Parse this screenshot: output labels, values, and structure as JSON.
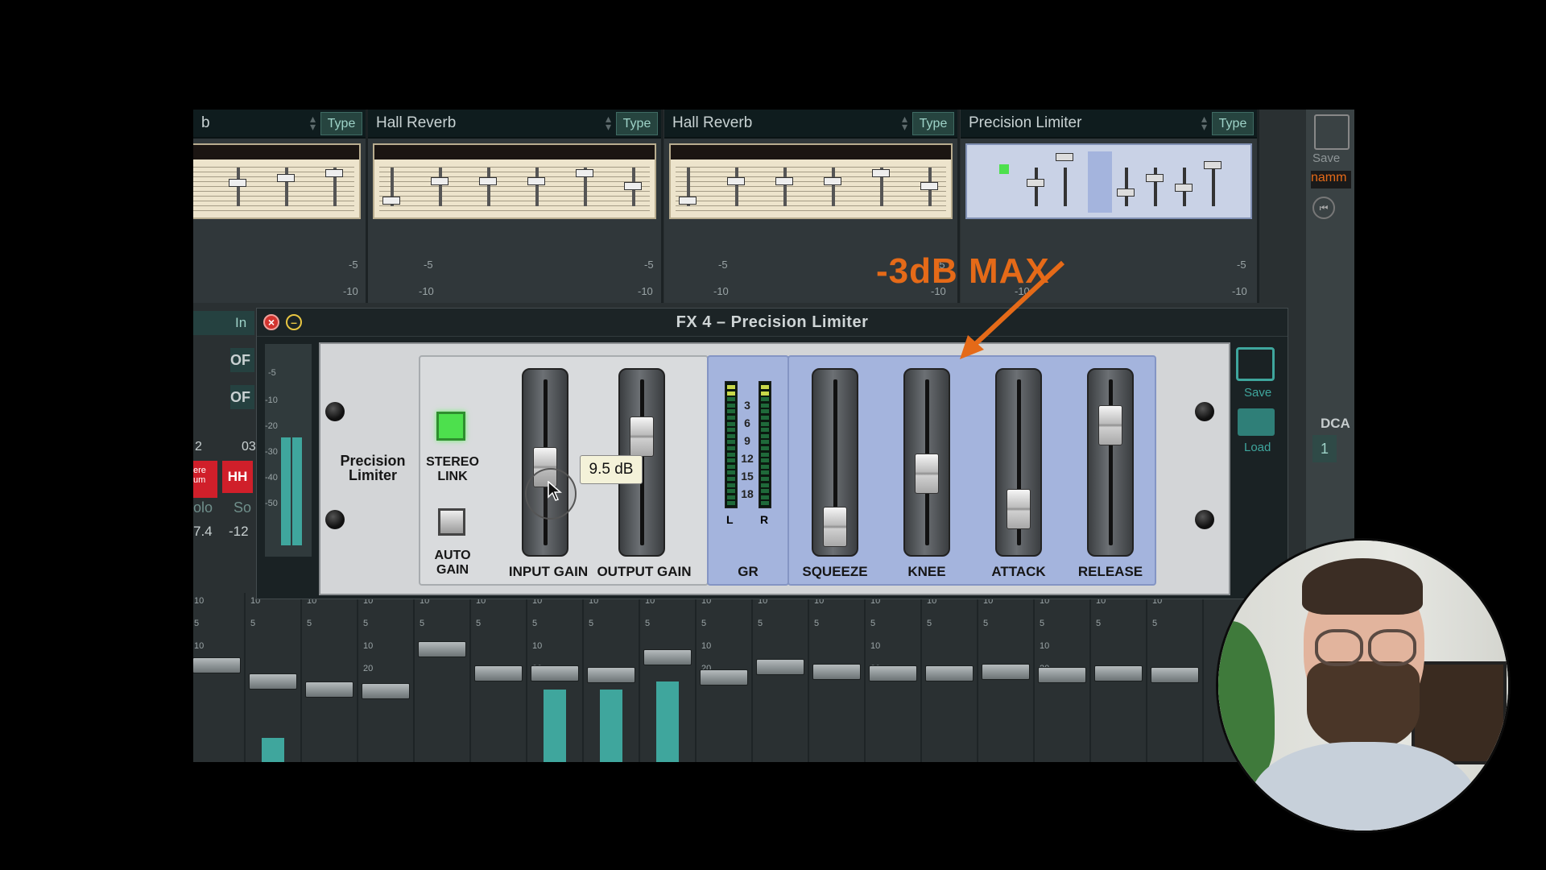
{
  "fx_slots": [
    {
      "name": "b",
      "type_label": "Type"
    },
    {
      "name": "Hall Reverb",
      "type_label": "Type"
    },
    {
      "name": "Hall Reverb",
      "type_label": "Type"
    },
    {
      "name": "Precision Limiter",
      "type_label": "Type"
    }
  ],
  "slot_scale": [
    "-5",
    "-10"
  ],
  "sidebar": {
    "save_label": "Save",
    "preset_text": "namm",
    "dca_label": "DCA",
    "dca_num": "1"
  },
  "fx_window": {
    "title": "FX 4 – Precision Limiter",
    "plugin_name": "Precision\nLimiter",
    "stereo_link_label": "STEREO\nLINK",
    "auto_gain_label": "AUTO\nGAIN",
    "input_gain_label": "INPUT GAIN",
    "output_gain_label": "OUTPUT GAIN",
    "gr_label": "GR",
    "gr_scale": [
      "3",
      "6",
      "9",
      "12",
      "15",
      "18"
    ],
    "gr_left": "L",
    "gr_right": "R",
    "squeeze_label": "SQUEEZE",
    "knee_label": "KNEE",
    "attack_label": "ATTACK",
    "release_label": "RELEASE",
    "save_label": "Save",
    "load_label": "Load",
    "left_scale": [
      "-5",
      "-10",
      "-20",
      "-30",
      "-40",
      "-50"
    ]
  },
  "tooltip": "9.5 dB",
  "annotation": "-3dB MAX",
  "left_strip": {
    "in_label": "In",
    "off1": "OF",
    "off2": "OF",
    "ch2": "2",
    "ch3": "03",
    "btn_a": "ere\num",
    "btn_b": "HH",
    "solo": "olo",
    "solo2": "So",
    "val1": "7.4",
    "val2": "-12"
  },
  "mixer_scale": [
    "10",
    "5",
    "10",
    "20"
  ],
  "colors": {
    "accent_orange": "#e56a18",
    "stereo_link_on": "#4de04d",
    "meter_teal": "#3fa69d",
    "type_button": "#26443f"
  }
}
